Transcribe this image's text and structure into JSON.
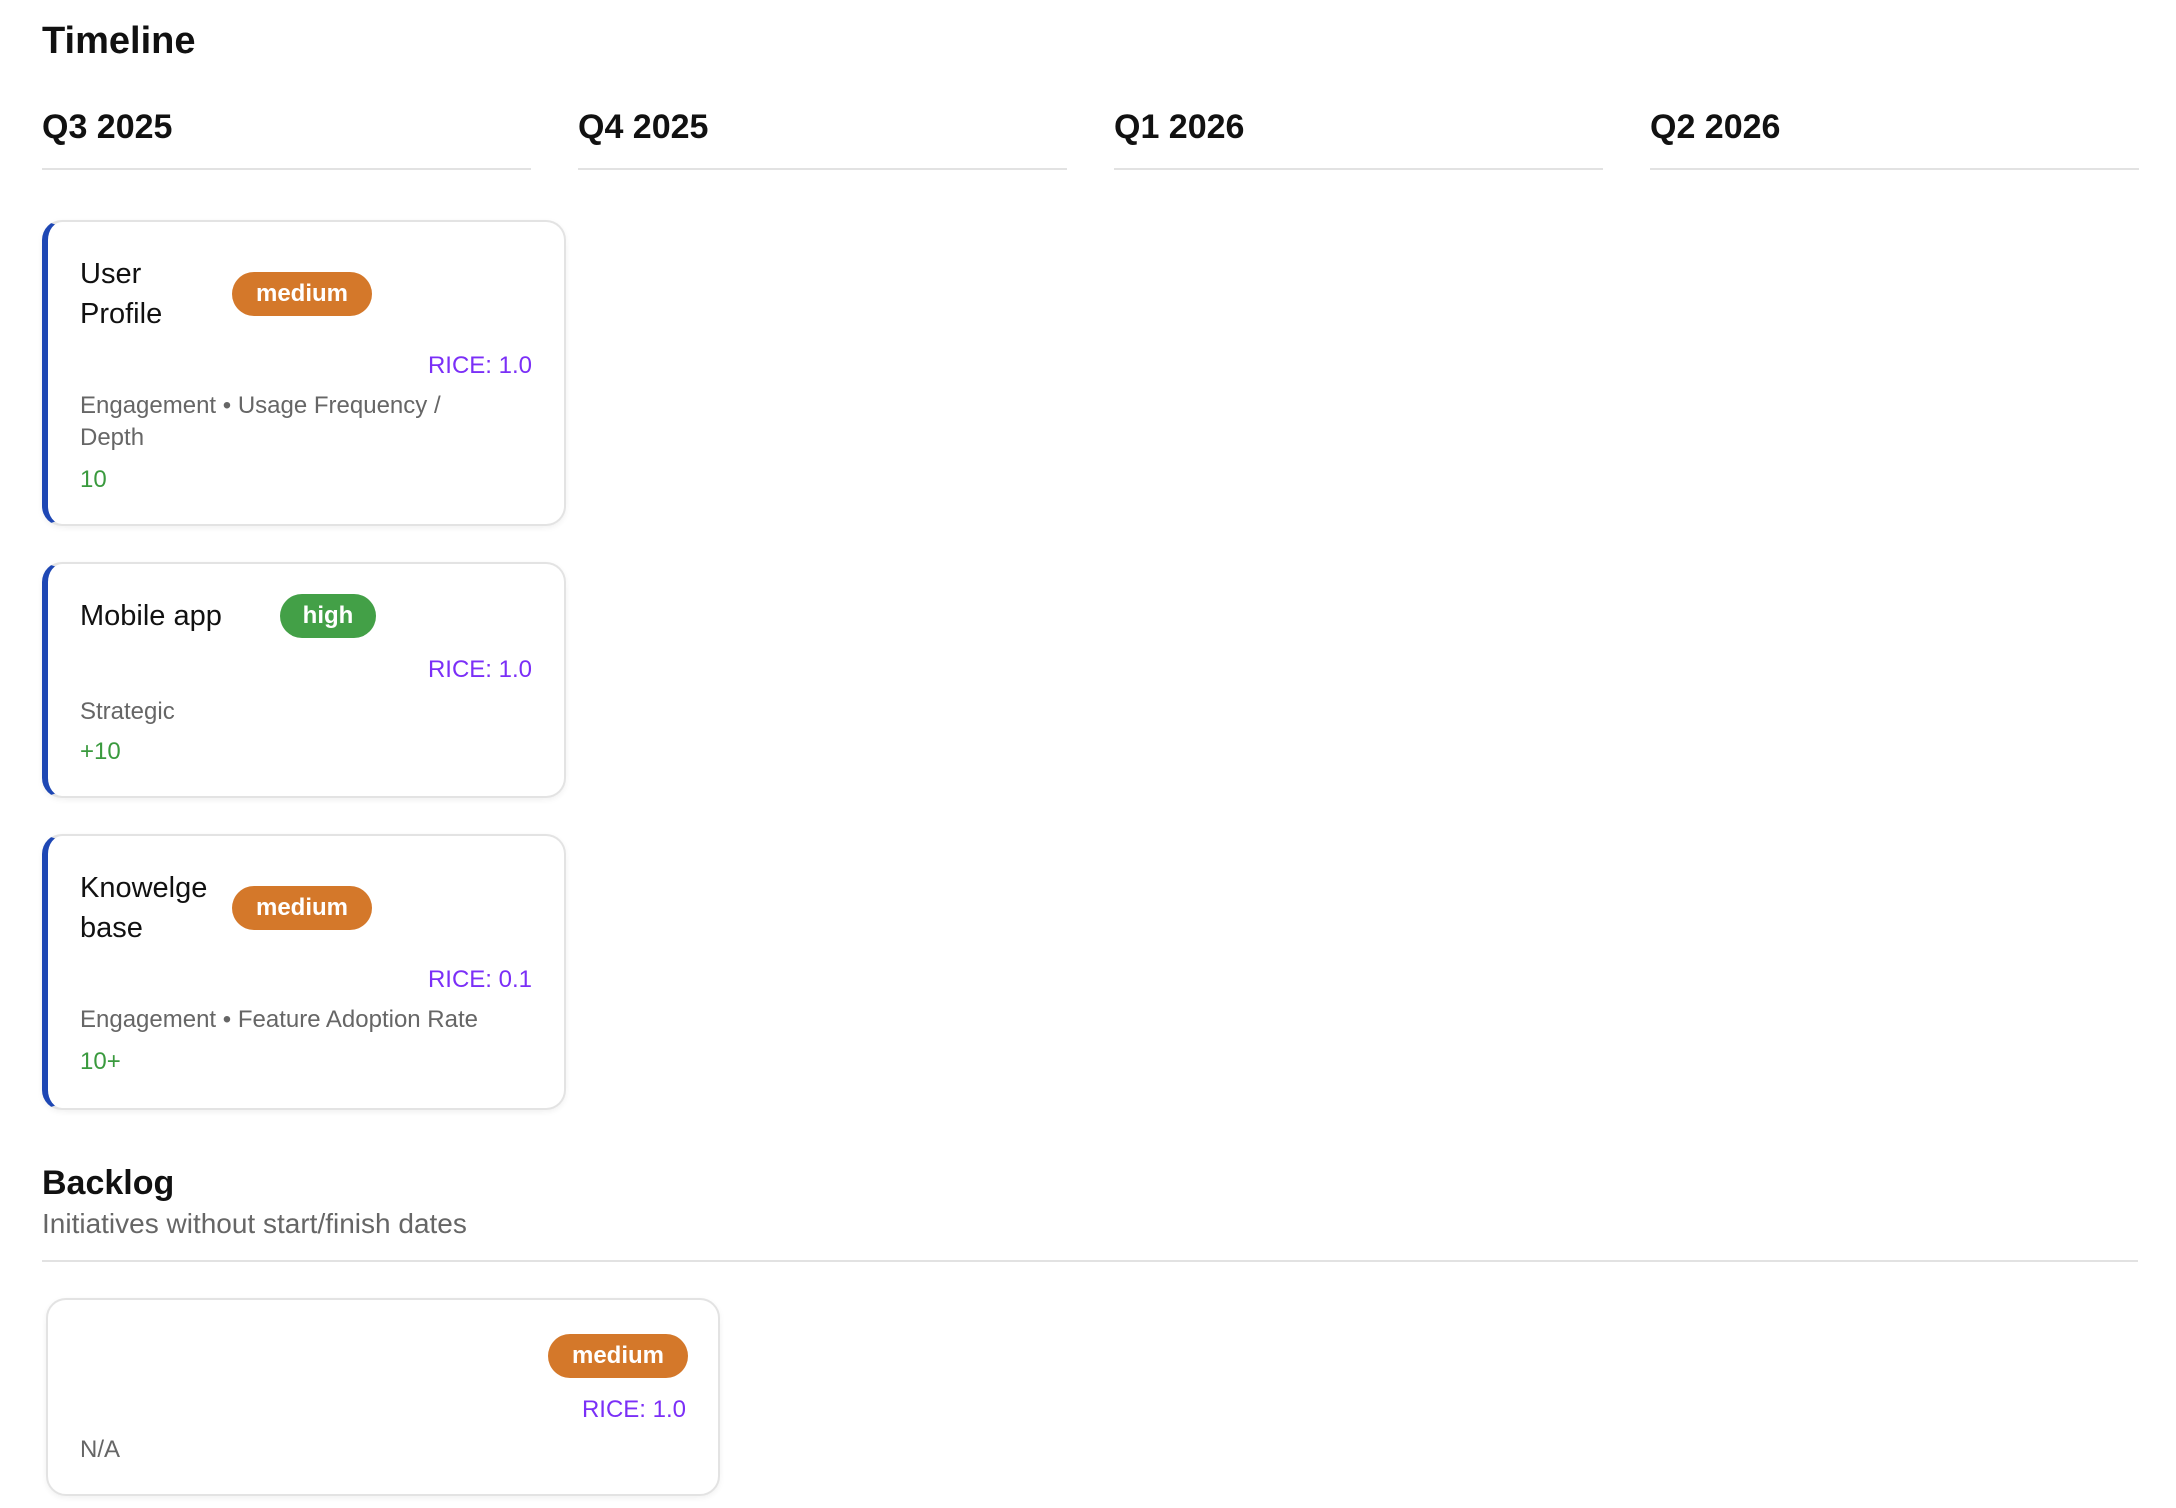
{
  "page": {
    "title": "Timeline"
  },
  "quarters": [
    "Q3 2025",
    "Q4 2025",
    "Q1 2026",
    "Q2 2026"
  ],
  "cards": [
    {
      "title": "User Profile",
      "priority": "medium",
      "rice": "RICE: 1.0",
      "meta": "Engagement • Usage Frequency / Depth",
      "metric": "10"
    },
    {
      "title": "Mobile app",
      "priority": "high",
      "rice": "RICE: 1.0",
      "meta": "Strategic",
      "metric": "+10"
    },
    {
      "title": "Knowelge base",
      "priority": "medium",
      "rice": "RICE: 0.1",
      "meta": "Engagement • Feature Adoption Rate",
      "metric": "10+"
    }
  ],
  "backlog": {
    "title": "Backlog",
    "subtitle": "Initiatives without start/finish dates",
    "cards": [
      {
        "priority": "medium",
        "rice": "RICE: 1.0",
        "meta": "N/A"
      }
    ]
  },
  "colors": {
    "accent": "#1e47b4",
    "medium": "#d4782a",
    "high": "#43a047",
    "rice": "#7b2ff7",
    "metric": "#3a9a3e"
  }
}
